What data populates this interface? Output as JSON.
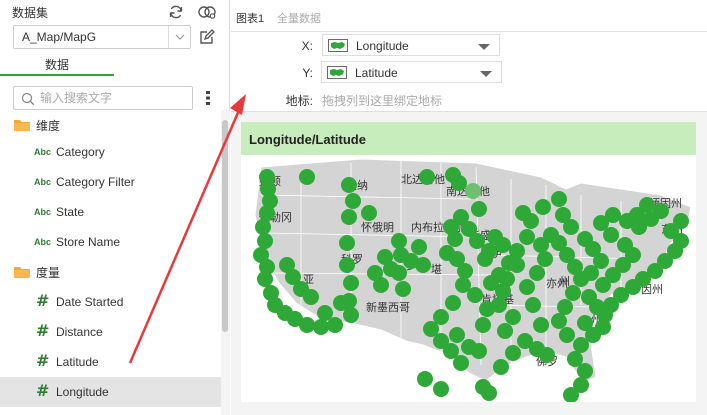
{
  "left": {
    "title": "数据集",
    "dataset_value": "A_Map/MapG",
    "tab_label": "数据",
    "search_placeholder": "输入搜索文字",
    "icons": {
      "refresh": "refresh-icon",
      "dataset_link": "dataset-link-icon",
      "edit": "edit-icon",
      "more": "more-icon",
      "search": "search-icon",
      "folder": "folder-icon"
    },
    "dimension_group": "维度",
    "dimension_prefix": "Abc",
    "dimensions": [
      "Category",
      "Category Filter",
      "State",
      "Store Name"
    ],
    "measure_group": "度量",
    "measure_prefix": "#",
    "measures": [
      "Date Started",
      "Distance",
      "Latitude",
      "Longitude"
    ],
    "selected_field": "Longitude"
  },
  "right": {
    "tabs": [
      "图表1",
      "全量数据"
    ],
    "x_label": "X:",
    "x_field": "Longitude",
    "y_label": "Y:",
    "y_field": "Latitude",
    "geo_label": "地标:",
    "geo_placeholder": "拖拽列到这里绑定地标"
  },
  "chart": {
    "title": "Longitude/Latitude",
    "state_labels": [
      "盛顿",
      "大纳",
      "北达科他",
      "俄勒冈",
      "南达科他",
      "缅因州",
      "怀俄明",
      "内布拉斯加",
      "华盛",
      "伊",
      "科罗",
      "多",
      "堪",
      "亚",
      "肯塔基",
      "新墨西哥",
      "亦州",
      "州",
      "佛罗",
      "州",
      "因州",
      "东州"
    ],
    "colors": {
      "accent": "#2ea836",
      "point": "#2ea836",
      "point_light": "#6cc06f",
      "map": "#d4d4d4",
      "title_bar": "#c8edbc",
      "arrow": "#e8393c"
    }
  }
}
